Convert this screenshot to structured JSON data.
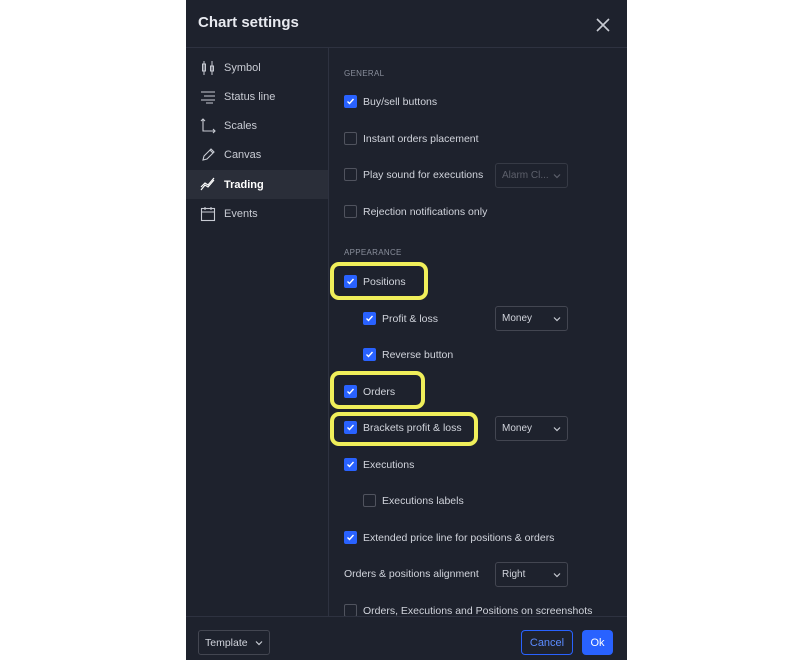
{
  "dialog": {
    "title": "Chart settings"
  },
  "sidebar": {
    "items": [
      {
        "label": "Symbol",
        "icon": "candles-icon"
      },
      {
        "label": "Status line",
        "icon": "status-line-icon"
      },
      {
        "label": "Scales",
        "icon": "scales-icon"
      },
      {
        "label": "Canvas",
        "icon": "pencil-icon"
      },
      {
        "label": "Trading",
        "icon": "trading-icon",
        "active": true
      },
      {
        "label": "Events",
        "icon": "calendar-icon"
      }
    ]
  },
  "general": {
    "heading": "GENERAL",
    "buy_sell": {
      "label": "Buy/sell buttons",
      "checked": true
    },
    "instant_orders": {
      "label": "Instant orders placement",
      "checked": false
    },
    "play_sound": {
      "label": "Play sound for executions",
      "checked": false,
      "select_value": "Alarm Cl..."
    },
    "rejection": {
      "label": "Rejection notifications only",
      "checked": false
    }
  },
  "appearance": {
    "heading": "APPEARANCE",
    "positions": {
      "label": "Positions",
      "checked": true
    },
    "profit_loss": {
      "label": "Profit & loss",
      "checked": true,
      "select_value": "Money"
    },
    "reverse": {
      "label": "Reverse button",
      "checked": true
    },
    "orders": {
      "label": "Orders",
      "checked": true
    },
    "brackets": {
      "label": "Brackets profit & loss",
      "checked": true,
      "select_value": "Money"
    },
    "executions": {
      "label": "Executions",
      "checked": true
    },
    "executions_labels": {
      "label": "Executions labels",
      "checked": false
    },
    "extended_price": {
      "label": "Extended price line for positions & orders",
      "checked": true
    },
    "alignment": {
      "label": "Orders & positions alignment",
      "select_value": "Right"
    },
    "screenshots": {
      "label": "Orders, Executions and Positions on screenshots",
      "checked": false
    }
  },
  "footer": {
    "template_label": "Template",
    "cancel_label": "Cancel",
    "ok_label": "Ok"
  },
  "colors": {
    "accent": "#2962ff",
    "highlight": "#f0ef5a",
    "background": "#1e222d"
  }
}
